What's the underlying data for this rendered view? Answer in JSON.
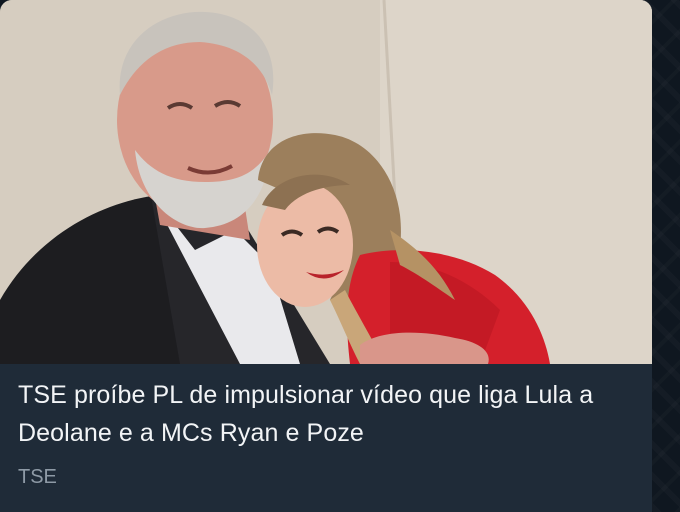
{
  "post": {
    "headline": "TSE proíbe PL de impulsionar vídeo que liga Lula a Deolane e a MCs Ryan e Poze",
    "source": "TSE"
  },
  "colors": {
    "card_background": "#1f2b38",
    "headline_text": "#f2f4f6",
    "source_text": "#8e9aa6"
  }
}
